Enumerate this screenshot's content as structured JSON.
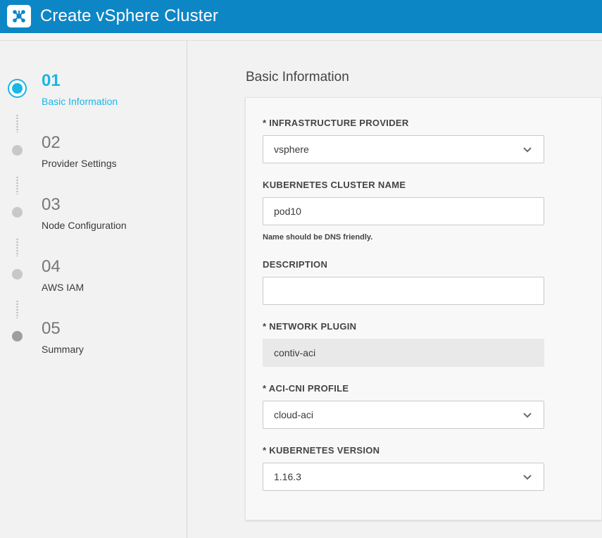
{
  "header": {
    "title": "Create vSphere Cluster",
    "logo_icon": "network-hub-icon",
    "bg_color": "#0d86c6"
  },
  "accent_color": "#1ab6e6",
  "steps": [
    {
      "num": "01",
      "label": "Basic Information",
      "state": "active"
    },
    {
      "num": "02",
      "label": "Provider Settings",
      "state": "pending"
    },
    {
      "num": "03",
      "label": "Node Configuration",
      "state": "pending"
    },
    {
      "num": "04",
      "label": "AWS IAM",
      "state": "pending"
    },
    {
      "num": "05",
      "label": "Summary",
      "state": "pending"
    }
  ],
  "form": {
    "section_title": "Basic Information",
    "infra_provider": {
      "label": "* INFRASTRUCTURE PROVIDER",
      "value": "vsphere"
    },
    "cluster_name": {
      "label": "KUBERNETES CLUSTER NAME",
      "value": "pod10",
      "hint": "Name should be DNS friendly."
    },
    "description": {
      "label": "DESCRIPTION",
      "value": ""
    },
    "network_plugin": {
      "label": "* NETWORK PLUGIN",
      "value": "contiv-aci"
    },
    "aci_cni_profile": {
      "label": "* ACI-CNI PROFILE",
      "value": "cloud-aci"
    },
    "k8s_version": {
      "label": "* KUBERNETES VERSION",
      "value": "1.16.3"
    }
  }
}
